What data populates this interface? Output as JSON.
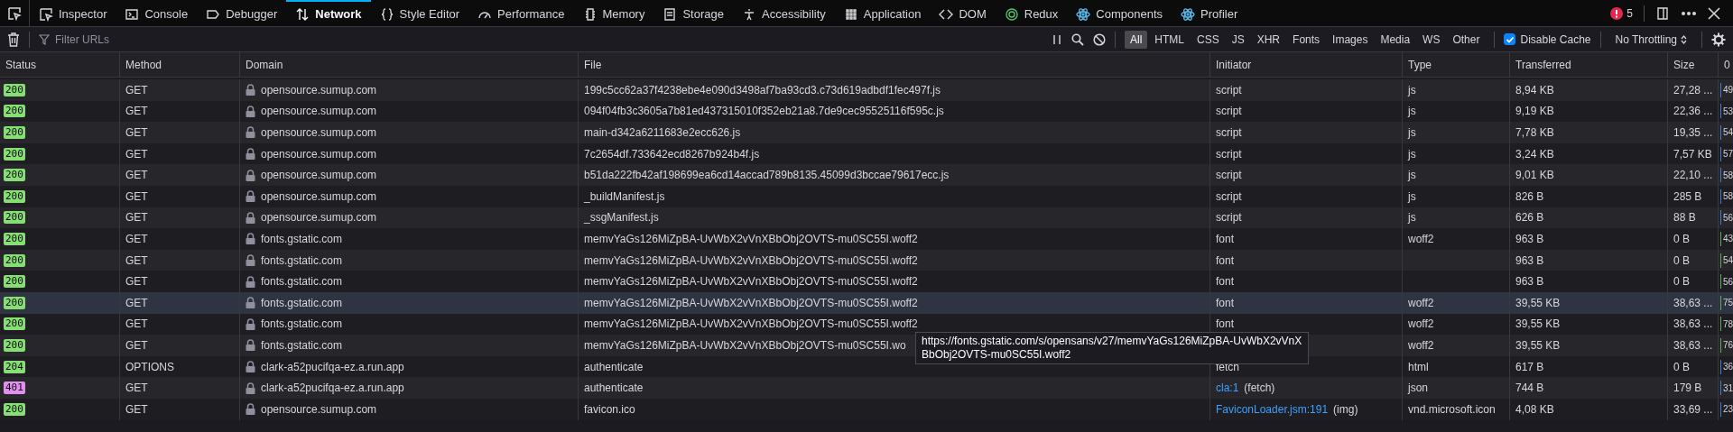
{
  "tabs": [
    {
      "label": "Inspector",
      "selected": false
    },
    {
      "label": "Console",
      "selected": false
    },
    {
      "label": "Debugger",
      "selected": false
    },
    {
      "label": "Network",
      "selected": true
    },
    {
      "label": "Style Editor",
      "selected": false
    },
    {
      "label": "Performance",
      "selected": false
    },
    {
      "label": "Memory",
      "selected": false
    },
    {
      "label": "Storage",
      "selected": false
    },
    {
      "label": "Accessibility",
      "selected": false
    },
    {
      "label": "Application",
      "selected": false
    },
    {
      "label": "DOM",
      "selected": false
    },
    {
      "label": "Redux",
      "selected": false
    },
    {
      "label": "Components",
      "selected": false
    },
    {
      "label": "Profiler",
      "selected": false
    }
  ],
  "error_count": "5",
  "filter": {
    "placeholder": "Filter URLs"
  },
  "type_filters": [
    {
      "label": "All",
      "selected": true
    },
    {
      "label": "HTML",
      "selected": false
    },
    {
      "label": "CSS",
      "selected": false
    },
    {
      "label": "JS",
      "selected": false
    },
    {
      "label": "XHR",
      "selected": false
    },
    {
      "label": "Fonts",
      "selected": false
    },
    {
      "label": "Images",
      "selected": false
    },
    {
      "label": "Media",
      "selected": false
    },
    {
      "label": "WS",
      "selected": false
    },
    {
      "label": "Other",
      "selected": false
    }
  ],
  "disable_cache": {
    "label": "Disable Cache",
    "checked": true
  },
  "throttling": "No Throttling",
  "columns": [
    "Status",
    "Method",
    "Domain",
    "File",
    "Initiator",
    "Type",
    "Transferred",
    "Size",
    "0"
  ],
  "rows": [
    {
      "status": "200",
      "color": "#86de74",
      "method": "GET",
      "domain": "opensource.sumup.com",
      "file": "199c5cc62a37f4238ebe4e090d3498af7ba93cd3.c73d619adbdf1fec497f.js",
      "initiator": "script",
      "type": "js",
      "transferred": "8,94 KB",
      "size": "27,28 ...",
      "timing": {
        "text": "49",
        "color": "#3d7fd1"
      },
      "selected": false
    },
    {
      "status": "200",
      "color": "#86de74",
      "method": "GET",
      "domain": "opensource.sumup.com",
      "file": "094f04fb3c3605a7b81ed437315010f352eb21a8.7de9cec95525116f595c.js",
      "initiator": "script",
      "type": "js",
      "transferred": "9,19 KB",
      "size": "22,36 ...",
      "timing": {
        "text": "53",
        "color": "#3d7fd1"
      },
      "selected": false
    },
    {
      "status": "200",
      "color": "#86de74",
      "method": "GET",
      "domain": "opensource.sumup.com",
      "file": "main-d342a6211683e2ecc626.js",
      "initiator": "script",
      "type": "js",
      "transferred": "7,78 KB",
      "size": "19,35 ...",
      "timing": {
        "text": "54",
        "color": "#3d7fd1"
      },
      "selected": false
    },
    {
      "status": "200",
      "color": "#86de74",
      "method": "GET",
      "domain": "opensource.sumup.com",
      "file": "7c2654df.733642ecd8267b924b4f.js",
      "initiator": "script",
      "type": "js",
      "transferred": "3,24 KB",
      "size": "7,57 KB",
      "timing": {
        "text": "57",
        "color": "#3d7fd1"
      },
      "selected": false
    },
    {
      "status": "200",
      "color": "#86de74",
      "method": "GET",
      "domain": "opensource.sumup.com",
      "file": "b51da222fb42af198699ea6cd14accad789b8135.45099d3bccae79617ecc.js",
      "initiator": "script",
      "type": "js",
      "transferred": "9,01 KB",
      "size": "22,10 ...",
      "timing": {
        "text": "58",
        "color": "#3d7fd1"
      },
      "selected": false
    },
    {
      "status": "200",
      "color": "#86de74",
      "method": "GET",
      "domain": "opensource.sumup.com",
      "file": "_buildManifest.js",
      "initiator": "script",
      "type": "js",
      "transferred": "826 B",
      "size": "285 B",
      "timing": {
        "text": "58",
        "color": "#3d7fd1"
      },
      "selected": false
    },
    {
      "status": "200",
      "color": "#86de74",
      "method": "GET",
      "domain": "opensource.sumup.com",
      "file": "_ssgManifest.js",
      "initiator": "script",
      "type": "js",
      "transferred": "626 B",
      "size": "88 B",
      "timing": {
        "text": "56",
        "color": "#3d7fd1"
      },
      "selected": false
    },
    {
      "status": "200",
      "color": "#86de74",
      "method": "GET",
      "domain": "fonts.gstatic.com",
      "file": "memvYaGs126MiZpBA-UvWbX2vVnXBbObj2OVTS-mu0SC55I.woff2",
      "initiator": "font",
      "type": "woff2",
      "transferred": "963 B",
      "size": "0 B",
      "timing": {
        "text": "43",
        "color": "#58b050"
      },
      "selected": false
    },
    {
      "status": "200",
      "color": "#86de74",
      "method": "GET",
      "domain": "fonts.gstatic.com",
      "file": "memvYaGs126MiZpBA-UvWbX2vVnXBbObj2OVTS-mu0SC55I.woff2",
      "initiator": "font",
      "transferred": "963 B",
      "size": "0 B",
      "timing": {
        "text": "54",
        "color": "#58b050"
      },
      "selected": false
    },
    {
      "status": "200",
      "color": "#86de74",
      "method": "GET",
      "domain": "fonts.gstatic.com",
      "file": "memvYaGs126MiZpBA-UvWbX2vVnXBbObj2OVTS-mu0SC55I.woff2",
      "initiator": "font",
      "transferred": "963 B",
      "size": "0 B",
      "timing": {
        "text": "56",
        "color": "#58b050"
      },
      "selected": false
    },
    {
      "status": "200",
      "color": "#86de74",
      "method": "GET",
      "domain": "fonts.gstatic.com",
      "file": "memvYaGs126MiZpBA-UvWbX2vVnXBbObj2OVTS-mu0SC55I.woff2",
      "initiator": "font",
      "type": "woff2",
      "transferred": "39,55 KB",
      "size": "38,63 ...",
      "timing": {
        "text": "75",
        "color": "#58b050"
      },
      "selected": true
    },
    {
      "status": "200",
      "color": "#86de74",
      "method": "GET",
      "domain": "fonts.gstatic.com",
      "file": "memvYaGs126MiZpBA-UvWbX2vVnXBbObj2OVTS-mu0SC55I.woff2",
      "initiator": "font",
      "type": "woff2",
      "transferred": "39,55 KB",
      "size": "38,63 ...",
      "timing": {
        "text": "78",
        "color": "#58b050"
      },
      "selected": false
    },
    {
      "status": "200",
      "color": "#86de74",
      "method": "GET",
      "domain": "fonts.gstatic.com",
      "file": "memvYaGs126MiZpBA-UvWbX2vVnXBbObj2OVTS-mu0SC55I.wo",
      "type": "woff2",
      "transferred": "39,55 KB",
      "size": "38,63 ...",
      "timing": {
        "text": "76",
        "color": "#58b050"
      },
      "selected": false
    },
    {
      "status": "204",
      "color": "#86de74",
      "method": "OPTIONS",
      "domain": "clark-a52pucifqa-ez.a.run.app",
      "file": "authenticate",
      "initiator": "fetch",
      "type": "html",
      "transferred": "617 B",
      "size": "0 B",
      "timing": {
        "text": "36",
        "color": "#3d7fd1"
      },
      "selected": false
    },
    {
      "status": "401",
      "color": "#e28ff0",
      "method": "GET",
      "domain": "clark-a52pucifqa-ez.a.run.app",
      "file": "authenticate",
      "initiator_link": "cla:1",
      "initiator": "(fetch)",
      "type": "json",
      "transferred": "744 B",
      "size": "179 B",
      "timing": {
        "text": "31",
        "color": "#3d7fd1"
      },
      "selected": false
    },
    {
      "status": "200",
      "color": "#86de74",
      "method": "GET",
      "domain": "opensource.sumup.com",
      "file": "favicon.ico",
      "initiator_link": "FaviconLoader.jsm:191",
      "initiator": "(img)",
      "type": "vnd.microsoft.icon",
      "transferred": "4,08 KB",
      "size": "33,69 ...",
      "timing": {
        "text": "23",
        "color": "#3d7fd1"
      },
      "selected": false
    }
  ],
  "tooltip": "https://fonts.gstatic.com/s/opensans/v27/memvYaGs126MiZpBA-UvWbX2vVnXBbObj2OVTS-mu0SC55I.woff2"
}
